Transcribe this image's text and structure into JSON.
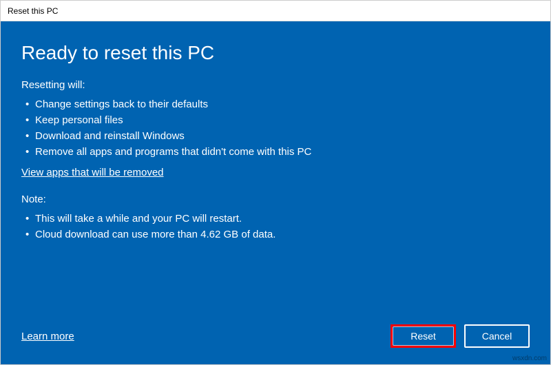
{
  "titlebar": {
    "title": "Reset this PC"
  },
  "heading": "Ready to reset this PC",
  "resetting": {
    "label": "Resetting will:",
    "items": [
      "Change settings back to their defaults",
      "Keep personal files",
      "Download and reinstall Windows",
      "Remove all apps and programs that didn't come with this PC"
    ]
  },
  "view_apps_link": "View apps that will be removed",
  "note": {
    "label": "Note:",
    "items": [
      "This will take a while and your PC will restart.",
      "Cloud download can use more than 4.62 GB of data."
    ]
  },
  "learn_more": "Learn more",
  "buttons": {
    "reset": "Reset",
    "cancel": "Cancel"
  },
  "watermark": "wsxdn.com"
}
